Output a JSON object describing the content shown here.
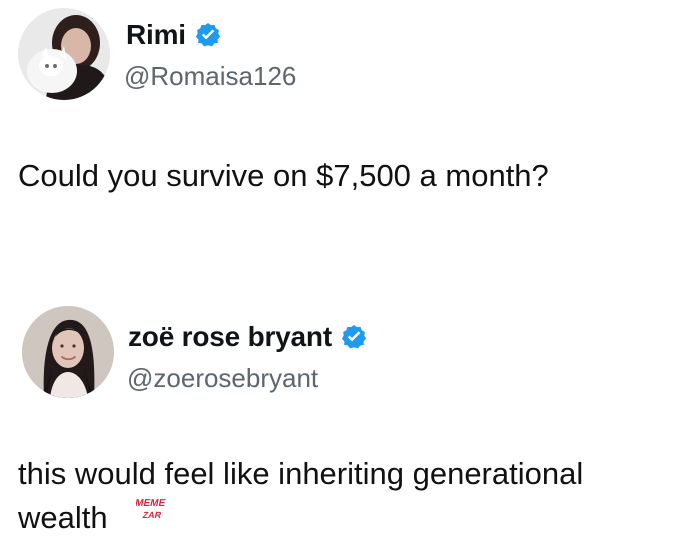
{
  "tweet_1": {
    "display_name": "Rimi",
    "handle": "@Romaisa126",
    "text": "Could you survive on $7,500 a month?",
    "verified": true
  },
  "tweet_2": {
    "display_name": "zoë rose bryant",
    "handle": "@zoerosebryant",
    "text_lines": [
      "this would feel like inheriting generational",
      "wealth"
    ],
    "verified": true
  },
  "watermark": {
    "text": "MEME ZAR"
  },
  "colors": {
    "verified_blue": "#1d9bf0",
    "handle_gray": "#5b6670",
    "text": "#111111",
    "watermark_red": "#d7263d"
  }
}
